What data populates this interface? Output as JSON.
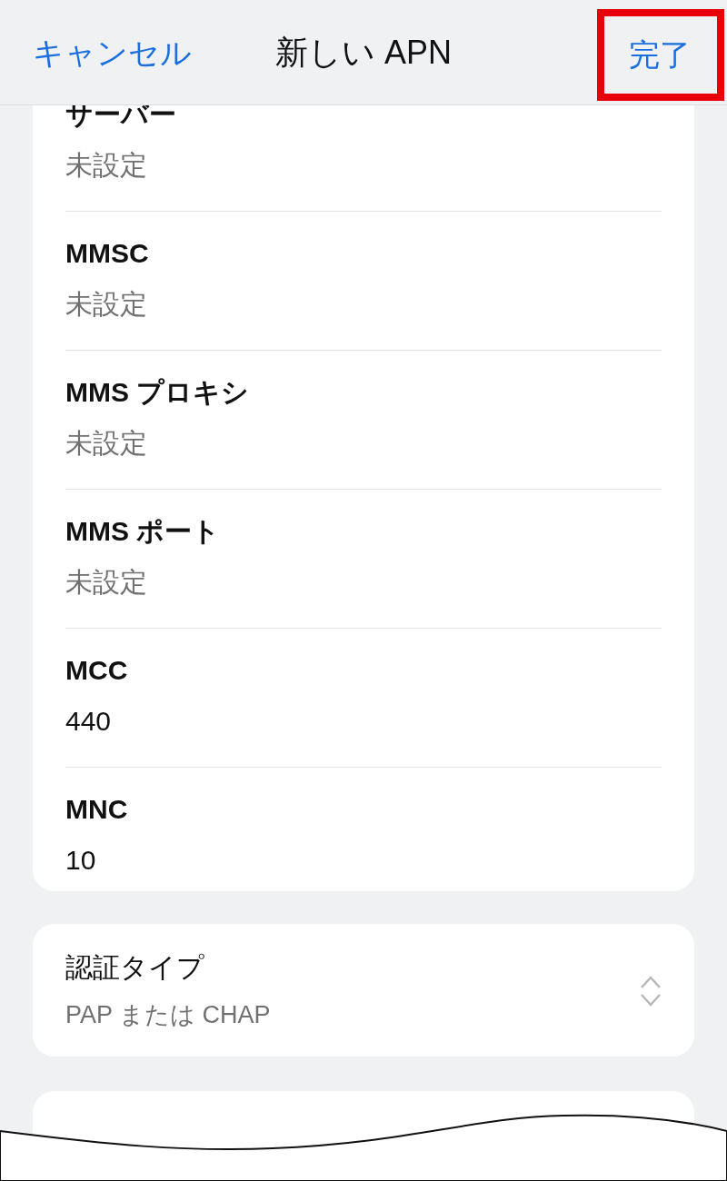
{
  "header": {
    "cancel": "キャンセル",
    "title": "新しい APN",
    "done": "完了",
    "done_highlighted": true
  },
  "fields": [
    {
      "label": "サーバー",
      "value": "未設定",
      "empty": true
    },
    {
      "label": "MMSC",
      "value": "未設定",
      "empty": true
    },
    {
      "label": "MMS プロキシ",
      "value": "未設定",
      "empty": true
    },
    {
      "label": "MMS ポート",
      "value": "未設定",
      "empty": true
    },
    {
      "label": "MCC",
      "value": "440",
      "empty": false
    },
    {
      "label": "MNC",
      "value": "10",
      "empty": false
    }
  ],
  "auth": {
    "label": "認証タイプ",
    "value": "PAP または CHAP",
    "kind": "picker"
  }
}
